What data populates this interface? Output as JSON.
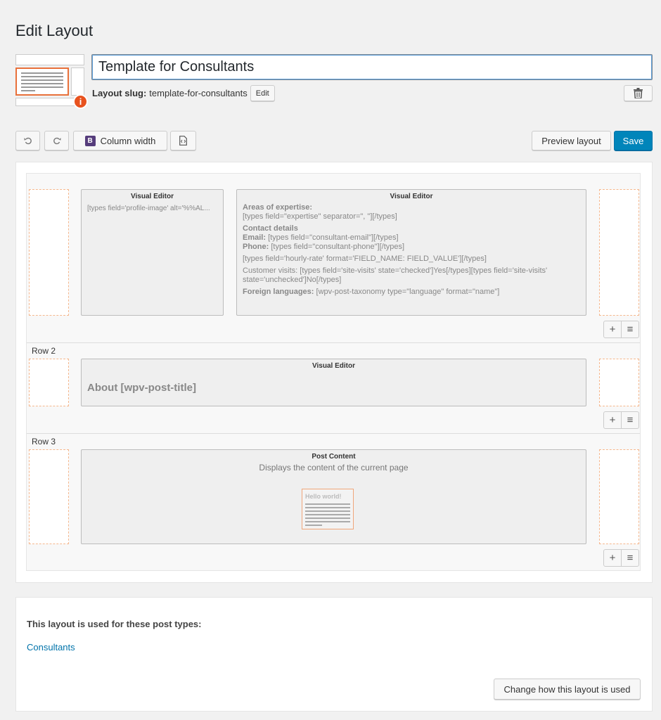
{
  "page": {
    "title": "Edit Layout"
  },
  "layout": {
    "name": "Template for Consultants",
    "slug_label": "Layout slug:",
    "slug_value": "template-for-consultants",
    "slug_edit_label": "Edit",
    "info_badge": "i"
  },
  "toolbar": {
    "column_width_label": "Column width",
    "bootstrap_icon": "B",
    "preview_label": "Preview layout",
    "save_label": "Save",
    "accent_color": "#0085ba"
  },
  "rows": [
    {
      "label": "",
      "cells": [
        {
          "title": "Visual Editor",
          "snippet": "[types field='profile-image' alt='%%AL..."
        },
        {
          "title": "Visual Editor",
          "areas_label": "Areas of expertise:",
          "areas_value": "[types field=\"expertise\" separator=\", \"][/types]",
          "contact_heading": "Contact details",
          "email_label": "Email:",
          "email_value": " [types field=\"consultant-email\"][/types]",
          "phone_label": "Phone:",
          "phone_value": " [types field=\"consultant-phone\"][/types]",
          "rate_value": "[types field='hourly-rate' format='FIELD_NAME: FIELD_VALUE'][/types]",
          "visits_value": "Customer visits: [types field='site-visits' state='checked']Yes[/types][types field='site-visits' state='unchecked']No[/types]",
          "languages_label": "Foreign languages:",
          "languages_value": " [wpv-post-taxonomy type=\"language\" format=\"name\"]"
        }
      ]
    },
    {
      "label": "Row 2",
      "cells": [
        {
          "title": "Visual Editor",
          "content": "About [wpv-post-title]"
        }
      ]
    },
    {
      "label": "Row 3",
      "cells": [
        {
          "title": "Post Content",
          "subtitle": "Displays the content of the current page",
          "preview_text": "Hello world!"
        }
      ]
    }
  ],
  "row_actions": {
    "add_icon": "+",
    "menu_icon": "≡"
  },
  "usage": {
    "heading": "This layout is used for these post types:",
    "post_type": "Consultants",
    "change_label": "Change how this layout is used"
  }
}
